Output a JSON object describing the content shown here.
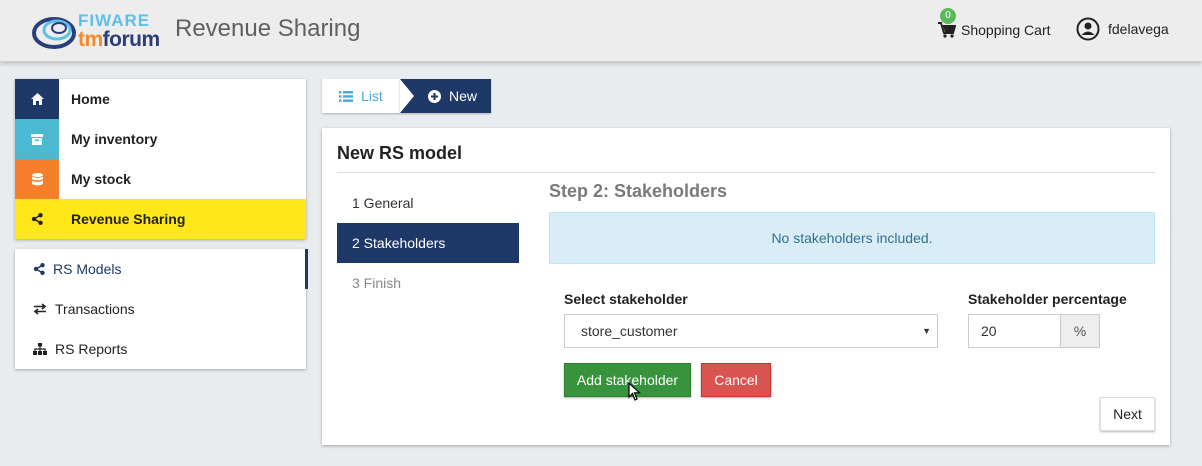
{
  "header": {
    "logo_top": "FIWARE",
    "logo_bottom_a": "tm",
    "logo_bottom_b": "forum",
    "app_title": "Revenue Sharing",
    "cart_count": "0",
    "cart_label": "Shopping Cart",
    "user_name": "fdelavega"
  },
  "sidebar": {
    "main": [
      {
        "label": "Home",
        "icon": "home-icon",
        "color": "#1e3868"
      },
      {
        "label": "My inventory",
        "icon": "archive-icon",
        "color": "#4ab9d1"
      },
      {
        "label": "My stock",
        "icon": "database-icon",
        "color": "#f57f2b"
      },
      {
        "label": "Revenue Sharing",
        "icon": "share-icon",
        "color": "#ffe71a"
      }
    ],
    "sub": [
      {
        "label": "RS Models",
        "icon": "share-icon"
      },
      {
        "label": "Transactions",
        "icon": "exchange-icon"
      },
      {
        "label": "RS Reports",
        "icon": "sitemap-icon"
      }
    ]
  },
  "breadcrumb": {
    "list_label": "List",
    "new_label": "New"
  },
  "form": {
    "title": "New RS model",
    "steps": [
      "1 General",
      "2 Stakeholders",
      "3 Finish"
    ],
    "step_title": "Step 2: Stakeholders",
    "alert": "No stakeholders included.",
    "select_label": "Select stakeholder",
    "select_value": "store_customer",
    "percentage_label": "Stakeholder percentage",
    "percentage_value": "20",
    "percentage_addon": "%",
    "add_button": "Add stakeholder",
    "cancel_button": "Cancel",
    "next_button": "Next"
  }
}
